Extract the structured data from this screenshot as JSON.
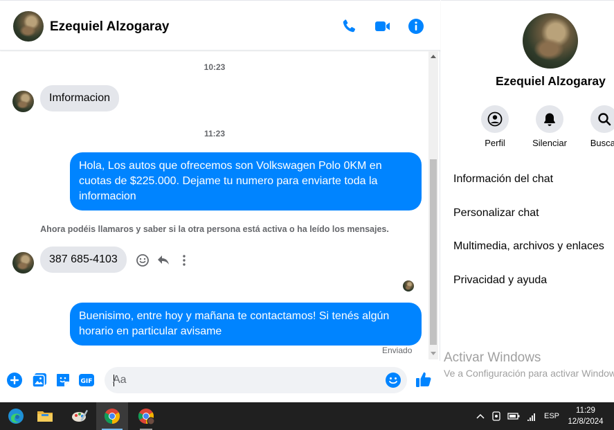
{
  "header": {
    "contact_name": "Ezequiel Alzogaray"
  },
  "messages": {
    "time_1": "10:23",
    "incoming_1": "Imformacion",
    "time_2": "11:23",
    "outgoing_1_line1": "Hola, Los autos que ofrecemos son Volkswagen Polo 0KM en",
    "outgoing_1_line2": "cuotas de $225.000. Dejame tu numero para enviarte toda la",
    "outgoing_1_line3": "informacion",
    "notice": "Ahora podéis llamaros y saber si la otra persona está activa o ha leído los mensajes.",
    "incoming_2": "387 685-4103",
    "outgoing_2_line1": "Buenisimo, entre hoy y mañana te contactamos! Si tenés algún",
    "outgoing_2_line2": "horario en particular avisame",
    "status": "Enviado"
  },
  "composer": {
    "placeholder": "Aa"
  },
  "info": {
    "name": "Ezequiel Alzogaray",
    "actions": [
      {
        "label": "Perfil",
        "icon": "profile-icon"
      },
      {
        "label": "Silenciar",
        "icon": "bell-icon"
      },
      {
        "label": "Buscar",
        "icon": "search-icon"
      }
    ],
    "menu": [
      "Información del chat",
      "Personalizar chat",
      "Multimedia, archivos y enlaces",
      "Privacidad y ayuda"
    ],
    "watermark_title": "Activar Windows",
    "watermark_sub": "Ve a Configuración para activar Windows."
  },
  "taskbar": {
    "language": "ESP",
    "time": "11:29",
    "date": "12/8/2024"
  },
  "colors": {
    "accent": "#0084ff",
    "incoming_bubble": "#e4e6eb",
    "taskbar": "#202020"
  }
}
